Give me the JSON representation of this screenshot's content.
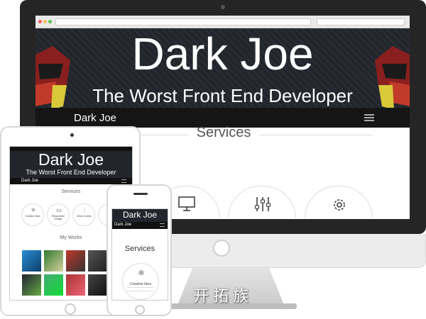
{
  "desktop": {
    "hero_title": "Dark Joe",
    "hero_subtitle": "The Worst Front End Developer",
    "nav_brand": "Dark Joe",
    "services_title": "Services"
  },
  "tablet": {
    "hero_title": "Dark Joe",
    "hero_subtitle": "The Worst Front End Developer",
    "nav_brand": "Dark Joe",
    "services_title": "Services",
    "service_items": [
      "Creative Idea",
      "Responsive Design",
      "Clean & Neat",
      "Su"
    ],
    "works_title": "My Works"
  },
  "phone": {
    "hero_title": "Dark Joe",
    "nav_brand": "Dark Joe",
    "services_title": "Services",
    "service_item": "Creative Idea"
  },
  "watermark": "开拓族",
  "colors": {
    "hero_bg": "#22262c",
    "nav_bg": "#151515",
    "device_frame": "#252525"
  }
}
